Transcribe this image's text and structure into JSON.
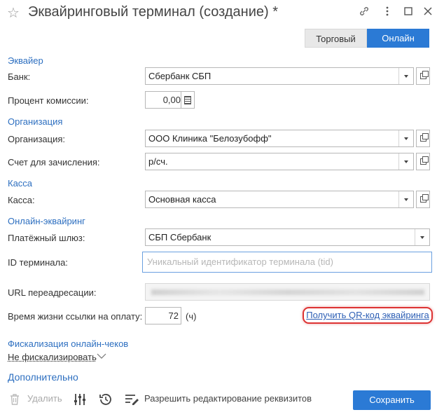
{
  "header": {
    "title": "Эквайринговый терминал (создание) *",
    "icons": [
      "star-icon",
      "link-icon",
      "more-icon",
      "minimize-icon",
      "close-icon"
    ]
  },
  "tabs": [
    {
      "label": "Торговый",
      "active": false
    },
    {
      "label": "Онлайн",
      "active": true
    }
  ],
  "sections": {
    "acquirer": "Эквайер",
    "organization": "Организация",
    "cash": "Касса",
    "online": "Онлайн-эквайринг",
    "fiscal": "Фискализация онлайн-чеков",
    "extra": "Дополнительно"
  },
  "fields": {
    "bank": {
      "label": "Банк:",
      "value": "Сбербанк СБП"
    },
    "commission": {
      "label": "Процент комиссии:",
      "value": "0,00"
    },
    "org": {
      "label": "Организация:",
      "value": "ООО Клиника \"Белозубофф\""
    },
    "account": {
      "label": "Счет для зачисления:",
      "value": "р/сч."
    },
    "cashdesk": {
      "label": "Касса:",
      "value": "Основная касса"
    },
    "gateway": {
      "label": "Платёжный шлюз:",
      "value": "СБП Сбербанк"
    },
    "terminal_id": {
      "label": "ID терминала:",
      "value": "",
      "placeholder": "Уникальный идентификатор терминала (tid)"
    },
    "redirect_url": {
      "label": "URL переадресации:"
    },
    "link_lifetime": {
      "label": "Время жизни ссылки на оплату:",
      "value": "72",
      "unit": "(ч)"
    }
  },
  "qr_link": "Получить QR-код эквайринга",
  "fiscal_option": "Не фискализировать",
  "toolbar": {
    "delete_label": "Удалить",
    "allow_edit_label": "Разрешить редактирование реквизитов",
    "save_label": "Сохранить"
  },
  "colors": {
    "accent": "#2b7ad5",
    "section": "#2d6fc0",
    "highlight": "#dd3333"
  }
}
